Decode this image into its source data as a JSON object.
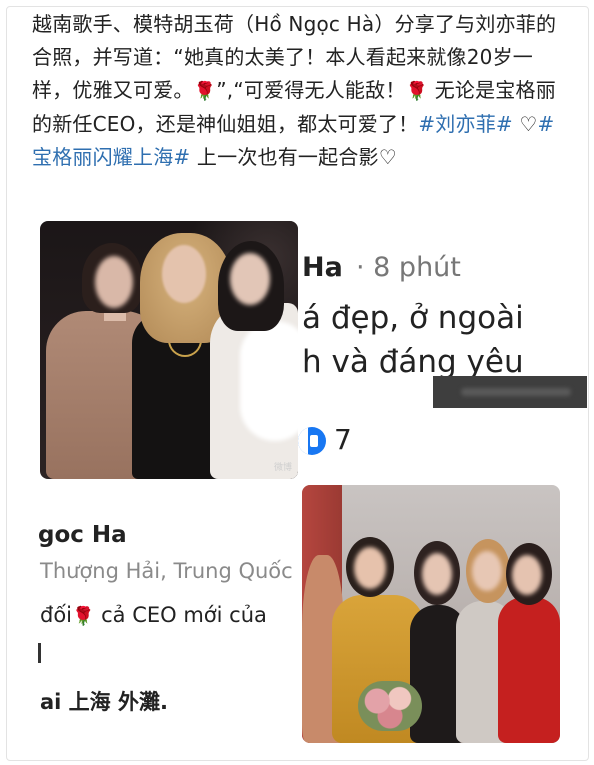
{
  "post": {
    "text_a": "越南歌手、模特胡玉荷（Hồ Ngọc Hà）分享了与刘亦菲的合照，并写道：“她真的太美了！本人看起来就像20岁一样，优雅又可爱。",
    "rose": "🌹",
    "text_b": "”,“可爱得无人能敌！",
    "text_c": " 无论是宝格丽的新任CEO，还是神仙姐姐，都太可爱了！",
    "hashtag1": "#刘亦菲#",
    "heart": " ♡",
    "hashtag2": "#宝格丽闪耀上海#",
    "text_d": " 上一次也有一起合影♡"
  },
  "photo1": {
    "watermark": "微博"
  },
  "background_post": {
    "author_fragment": "Ha",
    "time": "· 8 phút",
    "line1": "á đẹp, ở ngoài",
    "line2": "h và đáng yêu",
    "like_count": "7",
    "author2_fragment": "goc Ha",
    "location": "Thượng Hải, Trung Quốc",
    "line3_a": "đối",
    "line3_b": " cả CEO mới của",
    "line4": "ai 上海 外灘."
  },
  "colors": {
    "hashtag": "#2f6fb0",
    "like_blue": "#1877f2"
  }
}
